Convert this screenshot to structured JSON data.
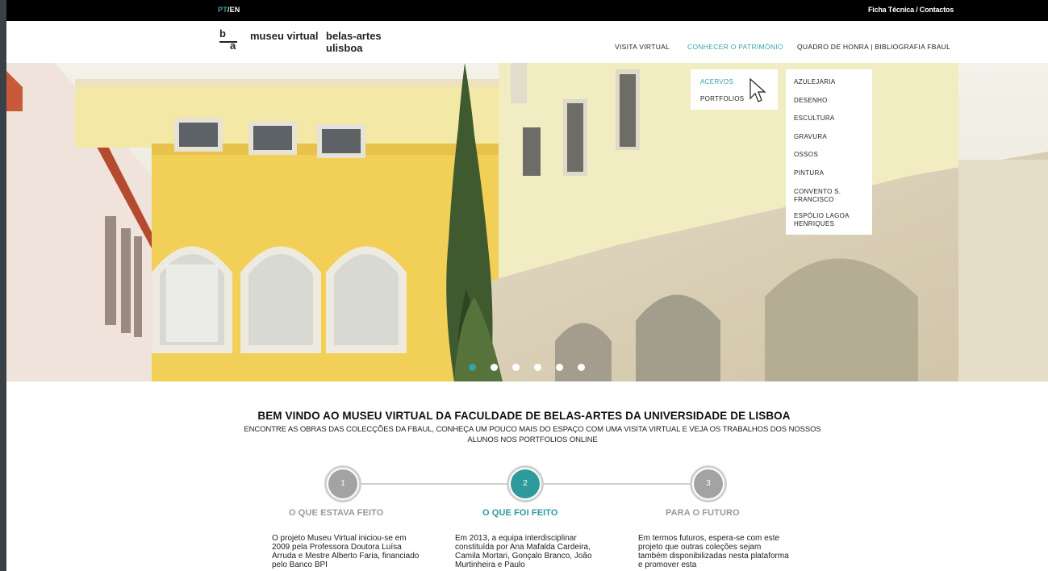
{
  "topbar": {
    "lang_pt": "PT",
    "lang_sep": " / ",
    "lang_en": "EN",
    "links": "Ficha Técnica / Contactos"
  },
  "logo": {
    "mark_b": "b",
    "mark_a": "a",
    "name_line1": "museu virtual",
    "name_line2": "belas-artes ulisboa"
  },
  "nav": {
    "items": [
      "VISITA VIRTUAL",
      "CONHECER O PATRIMÓNIO",
      "QUADRO DE HONRA | BIBLIOGRAFIA FBAUL"
    ]
  },
  "submenu": {
    "level1": [
      "ACERVOS",
      "PORTFOLIOS"
    ],
    "level2": [
      "AZULEJARIA",
      "DESENHO",
      "ESCULTURA",
      "GRAVURA",
      "OSSOS",
      "PINTURA",
      "CONVENTO S. FRANCISCO",
      "ESPÓLIO LAGOA HENRIQUES"
    ]
  },
  "welcome": {
    "title": "BEM VINDO AO MUSEU VIRTUAL DA FACULDADE DE BELAS-ARTES DA UNIVERSIDADE DE LISBOA",
    "subtitle": "ENCONTRE AS OBRAS DAS COLECÇÕES DA FBAUL, CONHEÇA UM POUCO MAIS DO ESPAÇO COM UMA VISITA VIRTUAL E VEJA OS TRABALHOS DOS NOSSOS ALUNOS NOS PORTFOLIOS ONLINE"
  },
  "steps": [
    {
      "number": "1",
      "title": "O QUE ESTAVA FEITO",
      "text": "O projeto Museu Virtual iniciou-se em 2009 pela Professora Doutora Luísa Arruda e Mestre Alberto Faria, financiado pelo Banco BPI"
    },
    {
      "number": "2",
      "title": "O QUE FOI FEITO",
      "text": "Em 2013, a equipa interdisciplinar constituída por Ana Mafalda Cardeira, Camila Mortari, Gonçalo Branco, João Murtinheira e Paulo"
    },
    {
      "number": "3",
      "title": "PARA O FUTURO",
      "text": "Em termos futuros, espera-se com este projeto que outras coleções sejam também disponibilizadas nesta plataforma e promover esta"
    }
  ],
  "slider": {
    "count": 6,
    "active_index": 0
  },
  "colors": {
    "accent": "#35a3a7",
    "topbar": "#000000"
  }
}
